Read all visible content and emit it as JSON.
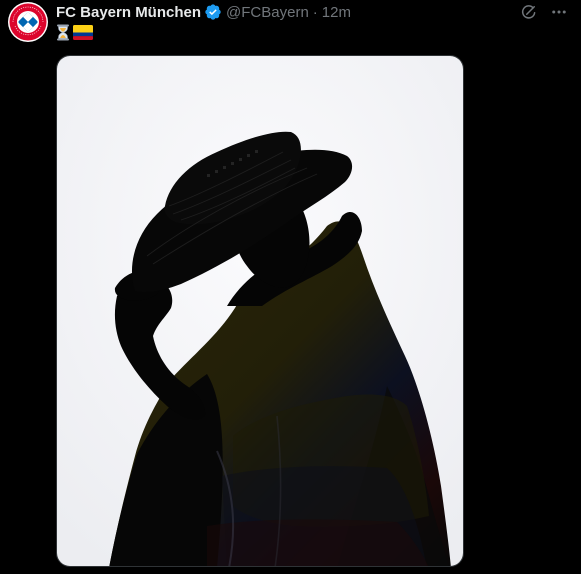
{
  "tweet": {
    "display_name": "FC Bayern München",
    "handle": "@FCBayern",
    "separator": "·",
    "timestamp": "12m",
    "verified": true,
    "text_emojis": [
      "hourglass-emoji",
      "colombia-flag-emoji"
    ]
  },
  "avatar": {
    "icon": "fc-bayern-crest",
    "colors": {
      "red": "#dc052d",
      "blue": "#0066b2",
      "white": "#ffffff"
    }
  },
  "actions": {
    "grok_icon": "grok-icon",
    "more_icon": "more-dots-icon"
  },
  "media": {
    "alt": "Silhouette of a person wearing a sombrero vueltiao and draped in a Colombian flag",
    "colors": {
      "background": "#f4f4f6",
      "silhouette": "#050505",
      "flag_yellow": "#2a2508",
      "flag_blue": "#0c1020",
      "flag_red": "#1a0808"
    }
  },
  "theme": {
    "background": "#000000",
    "text_primary": "#e7e9ea",
    "text_secondary": "#71767b",
    "verified_blue": "#1d9bf0",
    "border": "#2f3336"
  }
}
